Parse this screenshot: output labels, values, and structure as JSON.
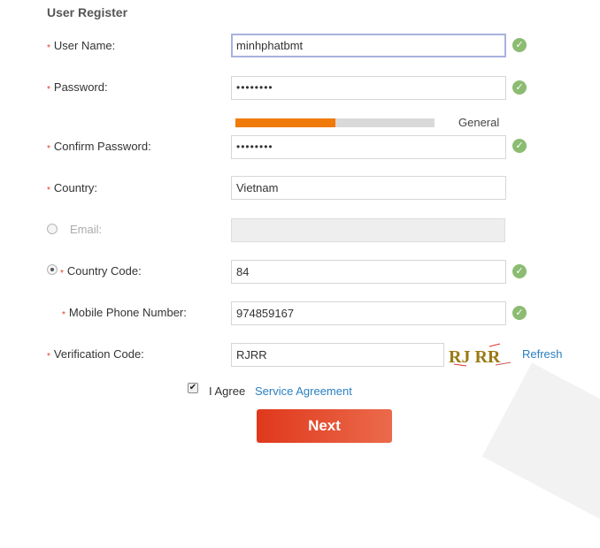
{
  "title": "User Register",
  "required_mark": "*",
  "check_glyph": "✓",
  "username": {
    "label": "User Name:",
    "value": "minhphatbmt"
  },
  "password": {
    "label": "Password:",
    "value": "••••••••"
  },
  "strength": {
    "label": "General",
    "level": 0.5,
    "color": "#f07a0a"
  },
  "confirm_password": {
    "label": "Confirm Password:",
    "value": "••••••••"
  },
  "country": {
    "label": "Country:",
    "value": "Vietnam"
  },
  "email": {
    "label": "Email:",
    "value": ""
  },
  "country_code": {
    "label": "Country Code:",
    "value": "84"
  },
  "mobile": {
    "label": "Mobile Phone Number:",
    "value": "974859167"
  },
  "verification": {
    "label": "Verification Code:",
    "value": "RJRR",
    "captcha_text": "RJ RR",
    "refresh_label": "Refresh"
  },
  "agreement": {
    "checked_glyph": "✔",
    "text": "I Agree",
    "link": "Service Agreement"
  },
  "next_button": "Next",
  "colors": {
    "accent": "#e03c1c",
    "link": "#2a7fc1",
    "valid": "#8bbc72"
  }
}
